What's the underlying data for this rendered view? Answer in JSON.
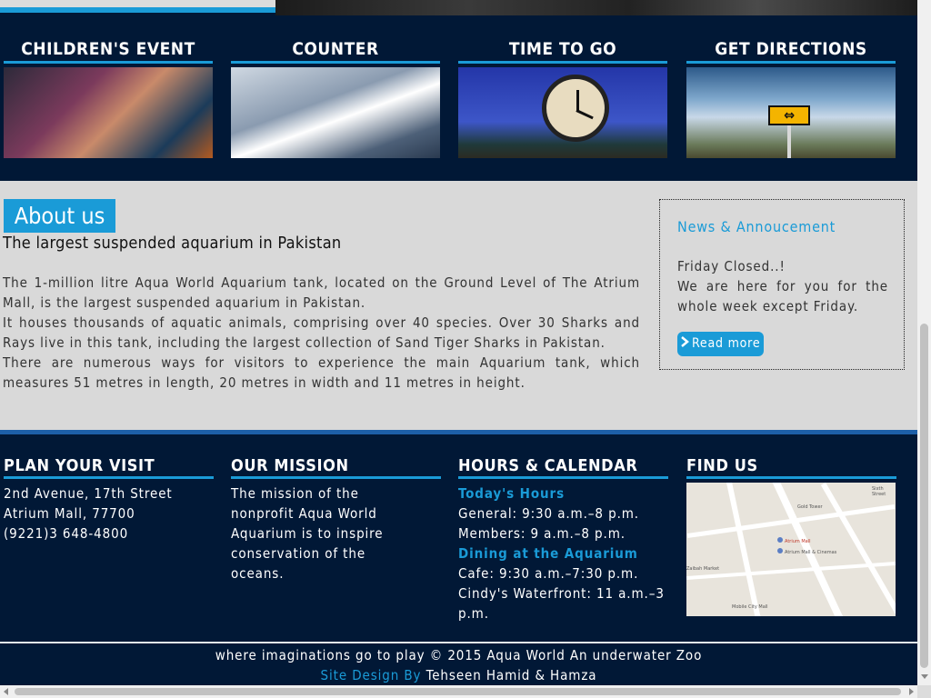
{
  "tiles": [
    {
      "title": "CHILDREN'S EVENT",
      "image": "children-at-aquarium-photo"
    },
    {
      "title": "COUNTER",
      "image": "ticket-counter-photo"
    },
    {
      "title": "TIME TO GO",
      "image": "clock-photo"
    },
    {
      "title": "GET DIRECTIONS",
      "image": "direction-sign-photo"
    }
  ],
  "about": {
    "tab_label": "About us",
    "subtitle": "The largest suspended aquarium in Pakistan",
    "paragraphs": [
      "The 1-million litre Aqua World Aquarium tank, located on the Ground Level of The Atrium Mall, is the largest suspended aquarium in Pakistan.",
      "It houses thousands of aquatic animals, comprising over 40 species. Over 30 Sharks and Rays live in this tank, including the largest collection of Sand Tiger Sharks in Pakistan.",
      "There are numerous ways for visitors to experience the main Aquarium tank, which measures 51 metres in length, 20 metres in width and 11 metres in height."
    ]
  },
  "news": {
    "title": "News & Annoucement",
    "lines": [
      "Friday Closed..!",
      "We are here for you for the whole week except Friday."
    ],
    "read_more": "Read more",
    "read_more_icon": "chevron-right-icon"
  },
  "footer": {
    "visit": {
      "heading": "PLAN YOUR VISIT",
      "lines": [
        "2nd Avenue, 17th Street",
        "Atrium Mall, 77700",
        "(9221)3 648-4800"
      ]
    },
    "mission": {
      "heading": "OUR MISSION",
      "text": "The mission of the nonprofit Aqua World Aquarium is to inspire conservation of the oceans."
    },
    "hours": {
      "heading": "HOURS & CALENDAR",
      "today_label": "Today's Hours",
      "general": "General: 9:30 a.m.–8 p.m.",
      "members": "Members: 9 a.m.–8 p.m.",
      "dining_label": "Dining at the Aquarium",
      "cafe": "Cafe: 9:30 a.m.–7:30 p.m.",
      "waterfront": "Cindy's Waterfront: 11 a.m.–3 p.m."
    },
    "find": {
      "heading": "FIND US",
      "map_labels": {
        "atrium": "Atrium Mall",
        "cinemas": "Atrium Mall & Cinemas",
        "gold": "Gold Tower",
        "mall": "Mobile City Mall",
        "zaibah": "Zaibah Market",
        "sixth": "Sixth Street"
      }
    }
  },
  "bottom": {
    "copyright": "where imaginations go to play © 2015 Aqua World An underwater Zoo",
    "credit_label": "Site Design By",
    "credit_names": "Tehseen Hamid & Hamza"
  },
  "colors": {
    "navy": "#011836",
    "accent": "#1a9bd7",
    "band": "#1d5fa8",
    "light": "#d9d9d9"
  }
}
